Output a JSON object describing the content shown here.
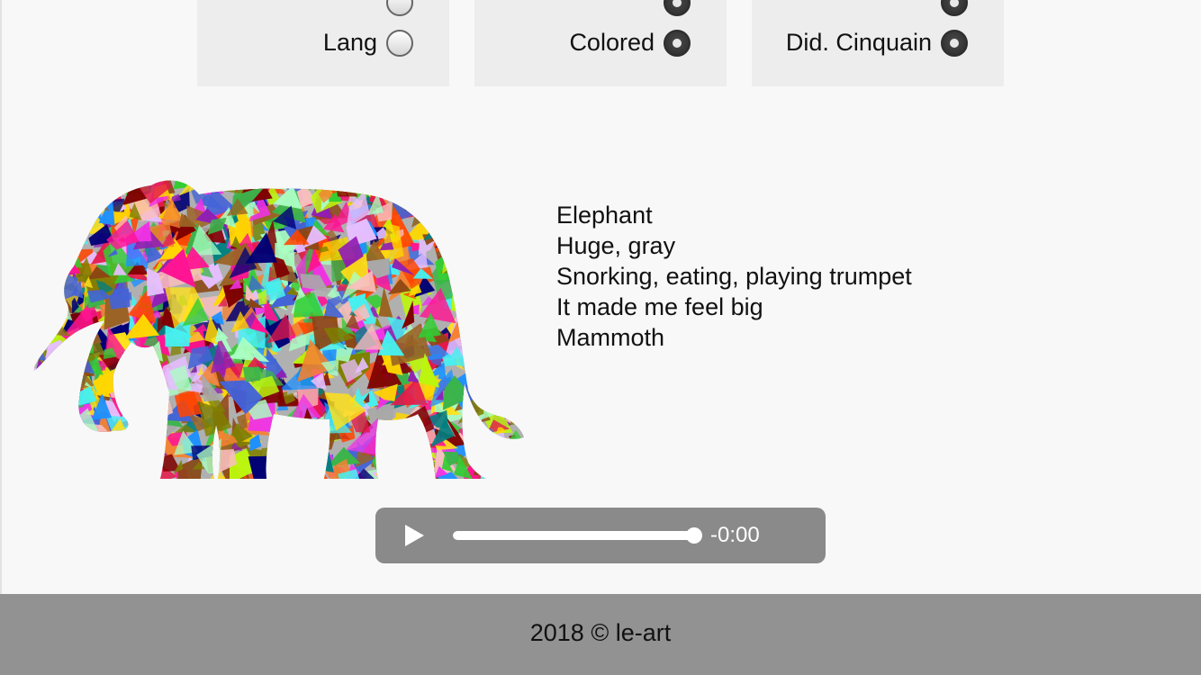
{
  "options": [
    {
      "partial_label": "",
      "label": "Lang",
      "checked": false
    },
    {
      "partial_label": "",
      "label": "Colored",
      "checked": true
    },
    {
      "partial_label": "",
      "label": "Did. Cinquain",
      "checked": true
    }
  ],
  "poem": {
    "lines": [
      "Elephant",
      "Huge, gray",
      "Snorking, eating, playing trumpet",
      "It made me feel big",
      "Mammoth"
    ]
  },
  "player": {
    "time": "-0:00",
    "progress": 1.0,
    "play_icon": "play-icon"
  },
  "footer": {
    "text": "2018 © le-art"
  },
  "colors": {
    "panel_bg": "#ededed",
    "page_bg": "#f8f8f8",
    "footer_bg": "#929292",
    "player_bg": "#8a8a8a"
  }
}
